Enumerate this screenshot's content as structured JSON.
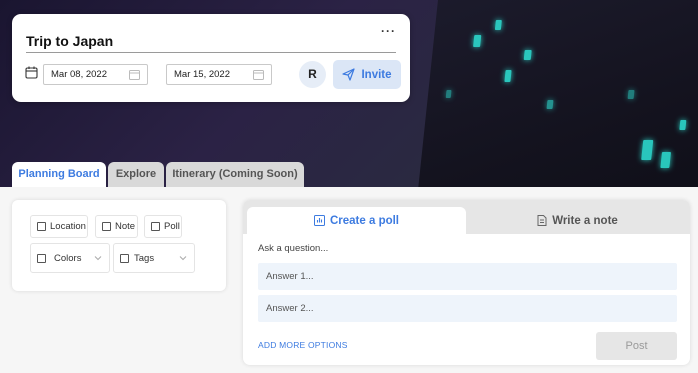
{
  "trip": {
    "title": "Trip to Japan",
    "more_label": "···",
    "start_date": "Mar 08, 2022",
    "date_separator": "-",
    "end_date": "Mar 15, 2022",
    "avatar_initial": "R",
    "invite_label": "Invite"
  },
  "tabs": [
    {
      "label": "Planning Board",
      "active": true
    },
    {
      "label": "Explore",
      "active": false
    },
    {
      "label": "Itinerary (Coming Soon)",
      "active": false
    }
  ],
  "filters": {
    "chips": [
      "Location",
      "Note",
      "Poll"
    ],
    "dropdowns": [
      "Colors",
      "Tags"
    ]
  },
  "composer": {
    "tabs": [
      {
        "label": "Create a poll",
        "icon": "poll-icon",
        "active": true
      },
      {
        "label": "Write a note",
        "icon": "note-icon",
        "active": false
      }
    ],
    "question_placeholder": "Ask a question...",
    "answers": [
      "Answer 1...",
      "Answer 2..."
    ],
    "add_more_label": "ADD MORE OPTIONS",
    "post_label": "Post"
  },
  "colors": {
    "accent": "#3d7be0",
    "accent_light": "#dbe6f6",
    "answer_bg": "#eef4fb",
    "window_glow": "#2ee6d8"
  }
}
